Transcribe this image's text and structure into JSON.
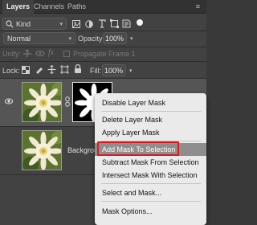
{
  "tabs": [
    "Layers",
    "Channels",
    "Paths"
  ],
  "filter": {
    "kind": "Kind"
  },
  "blend": {
    "mode": "Normal",
    "opacity_label": "Opacity:",
    "opacity": "100%"
  },
  "unify": {
    "label": "Unify:",
    "propagate": "Propagate Frame 1"
  },
  "lock": {
    "label": "Lock:",
    "fill_label": "Fill:",
    "fill": "100%"
  },
  "layers": [
    {
      "name": "",
      "has_mask": true,
      "visible": true,
      "selected": true
    },
    {
      "name": "Backgrou",
      "has_mask": false,
      "visible": false,
      "selected": false
    }
  ],
  "context_menu": {
    "items": [
      "Disable Layer Mask",
      "Delete Layer Mask",
      "Apply Layer Mask",
      "Add Mask To Selection",
      "Subtract Mask From Selection",
      "Intersect Mask With Selection",
      "Select and Mask...",
      "Mask Options..."
    ],
    "highlighted": "Add Mask To Selection"
  },
  "colors": {
    "panel": "#424242",
    "tabbar": "#323232",
    "menu": "#eaeaea",
    "hover": "#8e8e8e",
    "highlight_frame": "#e0181e"
  }
}
